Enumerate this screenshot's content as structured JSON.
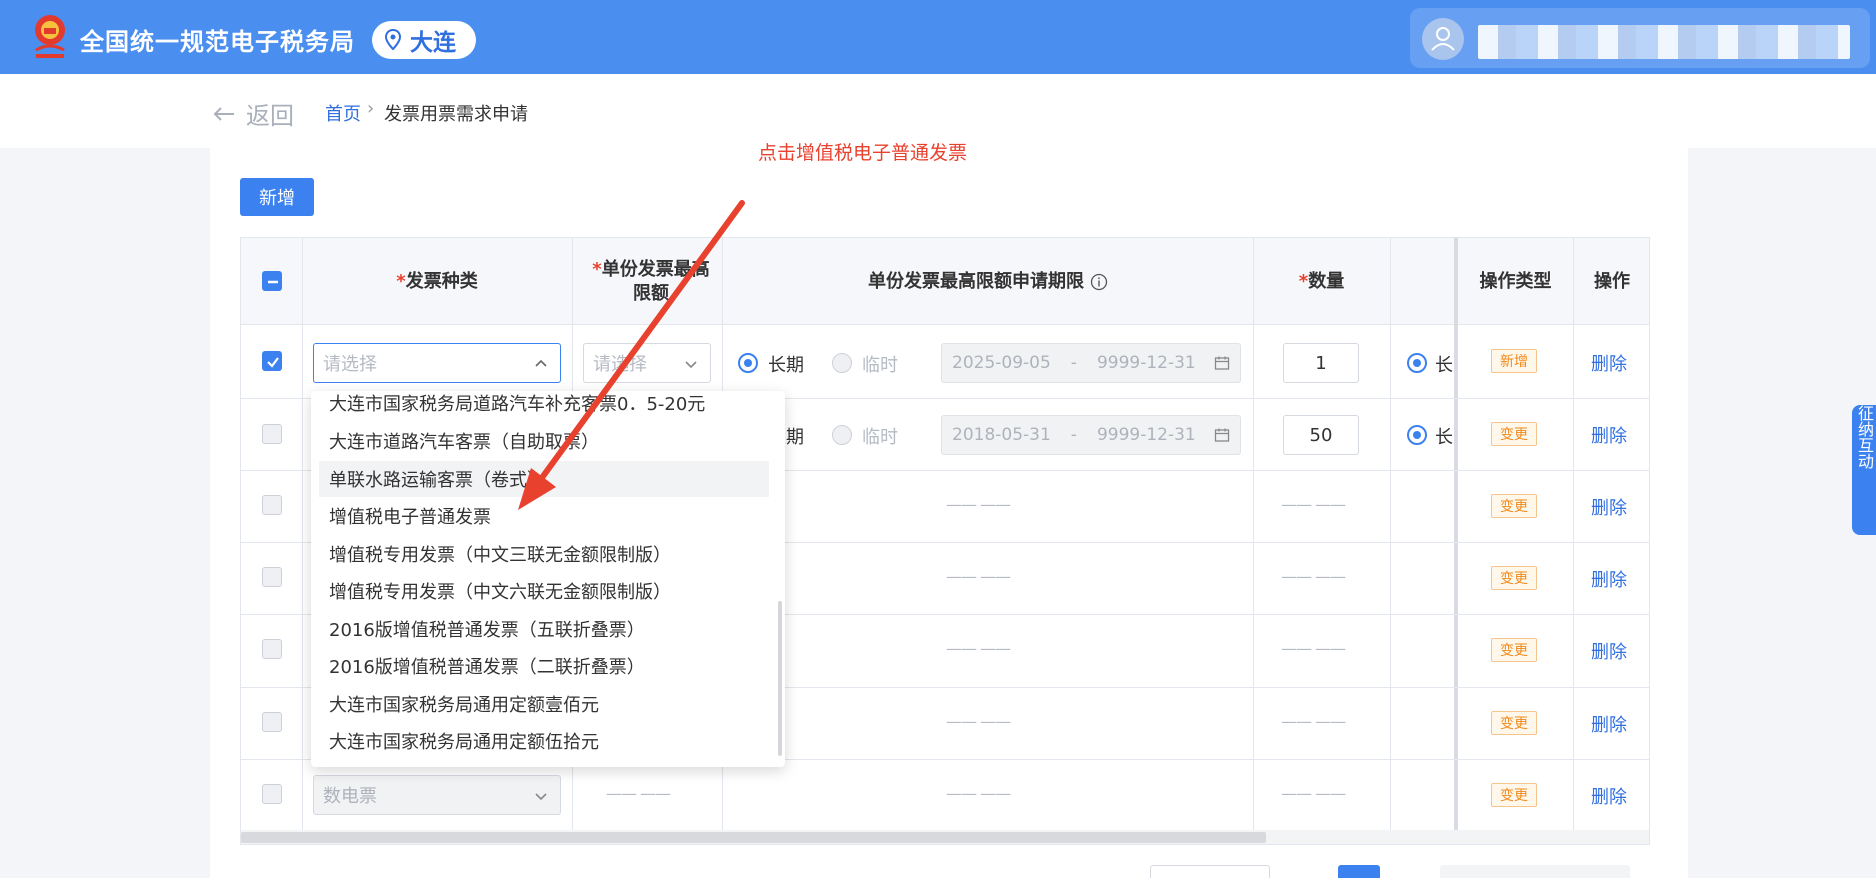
{
  "header": {
    "app_title": "全国统一规范电子税务局",
    "city": "大连"
  },
  "breadcrumb": {
    "back_label": "返回",
    "home": "首页",
    "separator": "›",
    "current": "发票用票需求申请"
  },
  "annotation": "点击增值税电子普通发票",
  "toolbar": {
    "add_label": "新增"
  },
  "table": {
    "headers": {
      "invoice_type": "发票种类",
      "max_amount": "单份发票最高限额",
      "period": "单份发票最高限额申请期限",
      "quantity": "数量",
      "op_type": "操作类型",
      "action": "操作",
      "required_mark": "*"
    },
    "rows": [
      {
        "type_placeholder": "请选择",
        "amount_placeholder": "请选择",
        "period_long": "长期",
        "period_temp": "临时",
        "date_start": "2025-09-05",
        "date_sep": "-",
        "date_end": "9999-12-31",
        "quantity": "1",
        "next_col_label": "长",
        "op_tag": "新增",
        "delete": "删除"
      },
      {
        "period_long": "长期",
        "period_temp": "临时",
        "date_start": "2018-05-31",
        "date_sep": "-",
        "date_end": "9999-12-31",
        "quantity": "50",
        "next_col_label": "长",
        "op_tag": "变更",
        "delete": "删除"
      },
      {
        "dash": "—— ——",
        "op_tag": "变更",
        "delete": "删除"
      },
      {
        "dash": "—— ——",
        "op_tag": "变更",
        "delete": "删除"
      },
      {
        "dash": "—— ——",
        "op_tag": "变更",
        "delete": "删除"
      },
      {
        "dash": "—— ——",
        "op_tag": "变更",
        "delete": "删除"
      },
      {
        "type_value": "数电票",
        "dash": "—— ——",
        "op_tag": "变更",
        "delete": "删除"
      }
    ]
  },
  "dropdown": {
    "options": [
      "大连市国家税务局道路汽车补充客票0．5-20元",
      "大连市道路汽车客票（自助取票）",
      "单联水路运输客票（卷式）",
      "增值税电子普通发票",
      "增值税专用发票（中文三联无金额限制版）",
      "增值税专用发票（中文六联无金额限制版）",
      "2016版增值税普通发票（五联折叠票）",
      "2016版增值税普通发票（二联折叠票）",
      "大连市国家税务局通用定额壹佰元",
      "大连市国家税务局通用定额伍拾元"
    ],
    "hovered_index": 2
  },
  "side_widget": "征纳互动",
  "colors": {
    "primary": "#3b82f0",
    "header": "#4a8ef0",
    "annotation": "#e8412e",
    "tag": "#f08a1c"
  }
}
